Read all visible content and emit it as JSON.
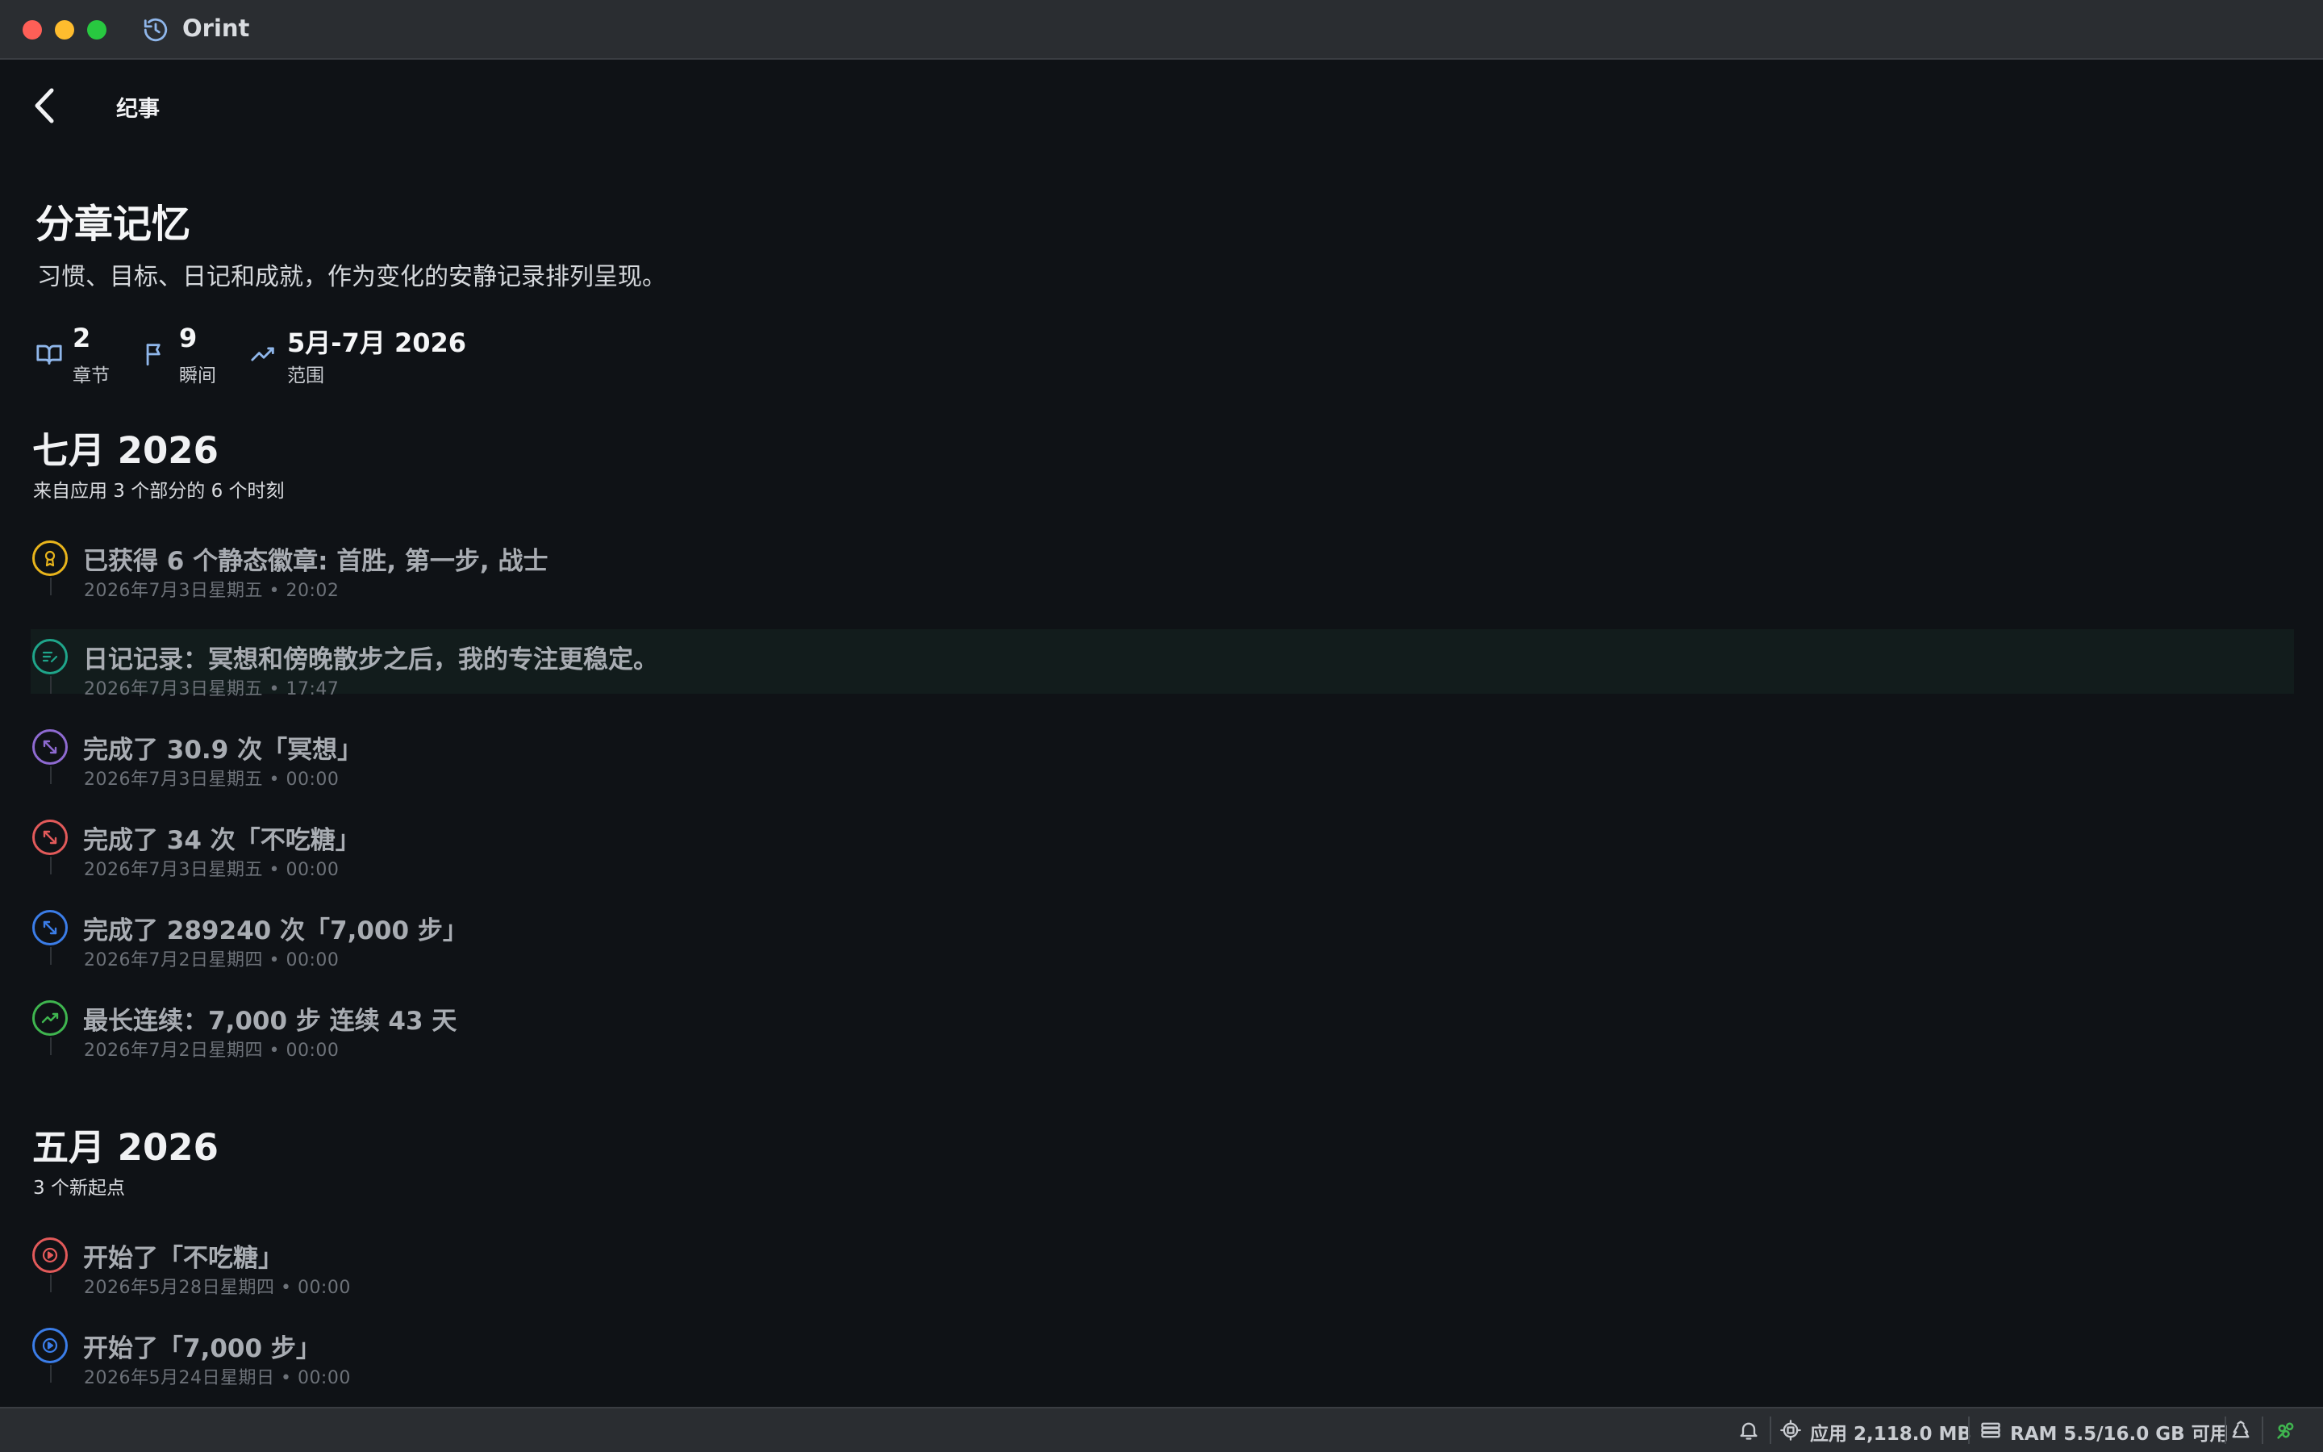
{
  "window": {
    "app_title": "Orint"
  },
  "nav": {
    "title": "纪事"
  },
  "header": {
    "title": "分章记忆",
    "subtitle": "习惯、目标、日记和成就，作为变化的安静记录排列呈现。"
  },
  "stats": [
    {
      "icon": "book-icon",
      "value": "2",
      "label": "章节"
    },
    {
      "icon": "flag-icon",
      "value": "9",
      "label": "瞬间"
    },
    {
      "icon": "trend-icon",
      "value": "5月-7月 2026",
      "label": "范围"
    }
  ],
  "sections": [
    {
      "title": "七月 2026",
      "subtitle": "来自应用 3 个部分的 6 个时刻",
      "items": [
        {
          "icon": "badge-icon",
          "color": "#e8b41c",
          "title": "已获得 6 个静态徽章: 首胜, 第一步, 战士",
          "date": "2026年7月3日星期五 • 20:02"
        },
        {
          "icon": "journal-icon",
          "color": "#1fa58a",
          "title": "日记记录：冥想和傍晚散步之后，我的专注更稳定。",
          "date": "2026年7月3日星期五 • 17:47"
        },
        {
          "icon": "expand-icon",
          "color": "#8e6ad1",
          "title": "完成了 30.9 次「冥想」",
          "date": "2026年7月3日星期五 • 00:00"
        },
        {
          "icon": "expand-icon",
          "color": "#e25a5a",
          "title": "完成了 34 次「不吃糖」",
          "date": "2026年7月3日星期五 • 00:00"
        },
        {
          "icon": "expand-icon",
          "color": "#3b7de8",
          "title": "完成了 289240 次「7,000 步」",
          "date": "2026年7月2日星期四 • 00:00"
        },
        {
          "icon": "trend-icon",
          "color": "#3fb54f",
          "title": "最长连续：7,000 步 连续 43 天",
          "date": "2026年7月2日星期四 • 00:00"
        }
      ]
    },
    {
      "title": "五月 2026",
      "subtitle": "3 个新起点",
      "items": [
        {
          "icon": "play-icon",
          "color": "#e25a5a",
          "title": "开始了「不吃糖」",
          "date": "2026年5月28日星期四 • 00:00"
        },
        {
          "icon": "play-icon",
          "color": "#3b7de8",
          "title": "开始了「7,000 步」",
          "date": "2026年5月24日星期日 • 00:00"
        }
      ]
    }
  ],
  "statusbar": {
    "app_memory": "应用 2,118.0 MB",
    "ram": "RAM 5.5/16.0 GB 可用"
  }
}
